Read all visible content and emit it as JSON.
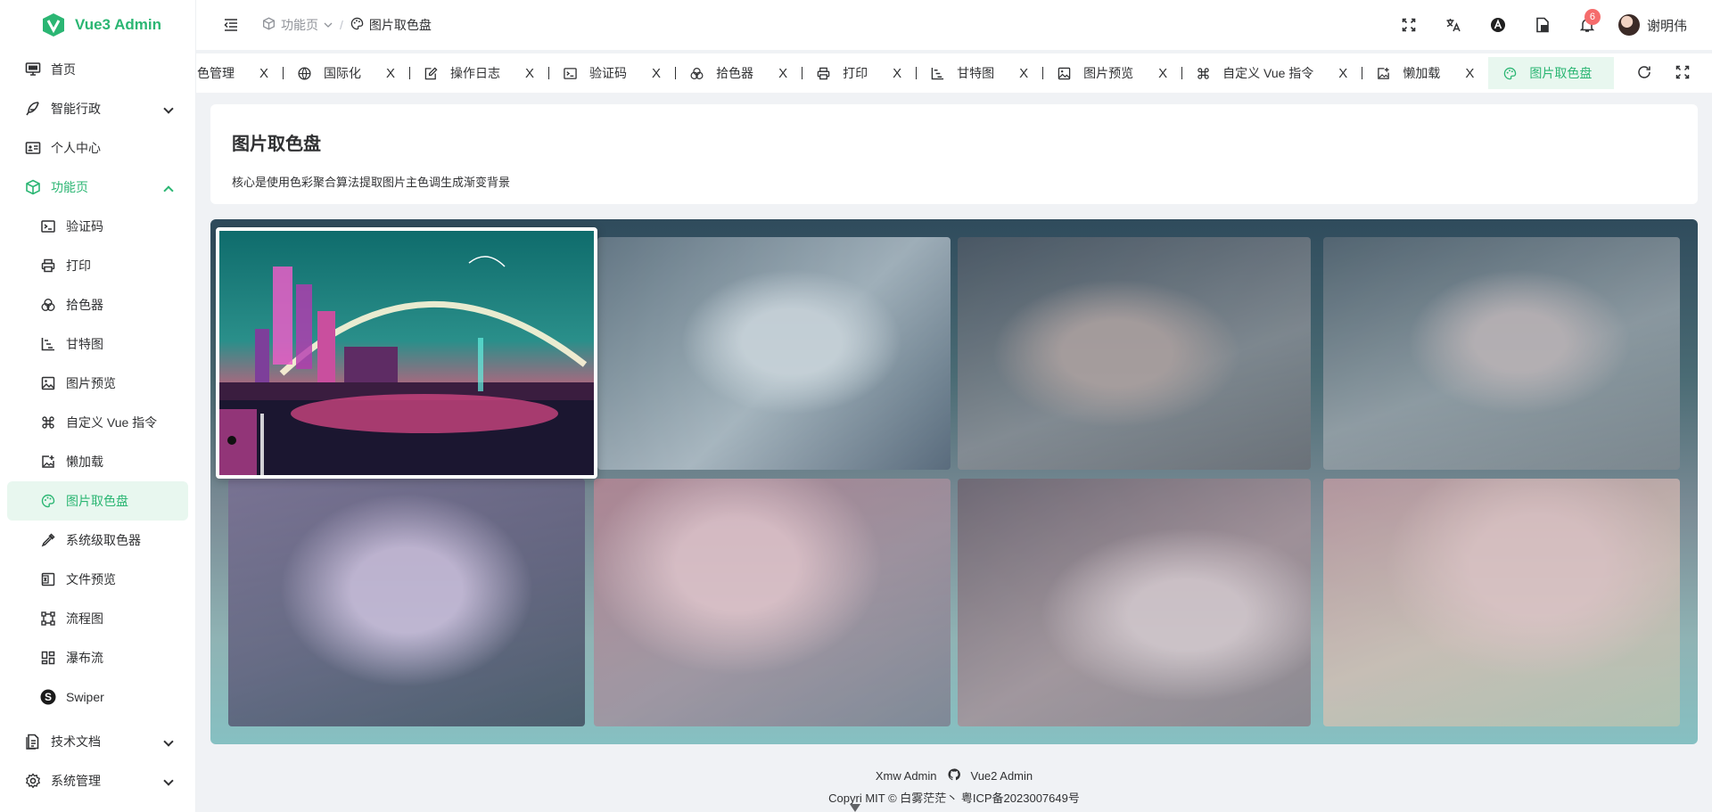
{
  "app": {
    "name": "Vue3 Admin",
    "brand_color": "#2bb673"
  },
  "sidebar": {
    "items": [
      {
        "label": "首页",
        "icon": "monitor-icon"
      },
      {
        "label": "智能行政",
        "icon": "feather-icon",
        "expandable": true
      },
      {
        "label": "个人中心",
        "icon": "id-card-icon"
      },
      {
        "label": "功能页",
        "icon": "box-icon",
        "expanded": true
      }
    ],
    "submenu": [
      {
        "label": "验证码",
        "icon": "terminal-icon"
      },
      {
        "label": "打印",
        "icon": "printer-icon"
      },
      {
        "label": "拾色器",
        "icon": "circles-icon"
      },
      {
        "label": "甘特图",
        "icon": "gantt-icon"
      },
      {
        "label": "图片预览",
        "icon": "image-icon"
      },
      {
        "label": "自定义 Vue 指令",
        "icon": "command-icon"
      },
      {
        "label": "懒加载",
        "icon": "image-plus-icon"
      },
      {
        "label": "图片取色盘",
        "icon": "palette-icon",
        "selected": true
      },
      {
        "label": "系统级取色器",
        "icon": "eyedropper-icon"
      },
      {
        "label": "文件预览",
        "icon": "file-x-icon"
      },
      {
        "label": "流程图",
        "icon": "flow-icon"
      },
      {
        "label": "瀑布流",
        "icon": "grid-icon"
      },
      {
        "label": "Swiper",
        "icon": "swiper-s-icon"
      }
    ],
    "bottom": [
      {
        "label": "技术文档",
        "icon": "document-icon"
      },
      {
        "label": "系统管理",
        "icon": "gear-icon"
      }
    ]
  },
  "header": {
    "breadcrumb": [
      "功能页",
      "图片取色盘"
    ],
    "notifications": "6",
    "user_name": "谢明伟"
  },
  "tabs": [
    {
      "label": "角色管理",
      "icon": ""
    },
    {
      "label": "国际化",
      "icon": "globe-icon"
    },
    {
      "label": "操作日志",
      "icon": "edit-log-icon"
    },
    {
      "label": "验证码",
      "icon": "terminal-icon"
    },
    {
      "label": "拾色器",
      "icon": "circles-icon"
    },
    {
      "label": "打印",
      "icon": "printer-icon"
    },
    {
      "label": "甘特图",
      "icon": "gantt-icon"
    },
    {
      "label": "图片预览",
      "icon": "image-icon"
    },
    {
      "label": "自定义 Vue 指令",
      "icon": "command-icon"
    },
    {
      "label": "懒加载",
      "icon": "image-plus-icon"
    },
    {
      "label": "图片取色盘",
      "icon": "palette-icon",
      "active": true
    }
  ],
  "tab_close": "X",
  "page": {
    "title": "图片取色盘",
    "description": "核心是使用色彩聚合算法提取图片主色调生成渐变背景"
  },
  "images": [
    {
      "name": "cyberpunk-city",
      "colors": [
        "#0f4b4f",
        "#e8457f"
      ],
      "selected": true
    },
    {
      "name": "silver-hair-girl",
      "colors": [
        "#6e7f8c",
        "#b6c3cc"
      ]
    },
    {
      "name": "glasses-girl",
      "colors": [
        "#4f5a66",
        "#8a8f96"
      ]
    },
    {
      "name": "street-girl",
      "colors": [
        "#5a6a76",
        "#9aa4ab"
      ]
    },
    {
      "name": "purple-hair-girl",
      "colors": [
        "#7a6f94",
        "#3f4a5c"
      ]
    },
    {
      "name": "pink-girl",
      "colors": [
        "#b98795",
        "#7d7f8f"
      ]
    },
    {
      "name": "car-girl",
      "colors": [
        "#6e6470",
        "#a69098"
      ]
    },
    {
      "name": "soft-girl",
      "colors": [
        "#c09aa2",
        "#b7c4b0"
      ]
    }
  ],
  "footer": {
    "line1_left": "Xmw Admin",
    "line1_right": "Vue2 Admin",
    "line2": "Copyri   MIT ©  白雾茫茫丶  粤ICP备2023007649号"
  }
}
